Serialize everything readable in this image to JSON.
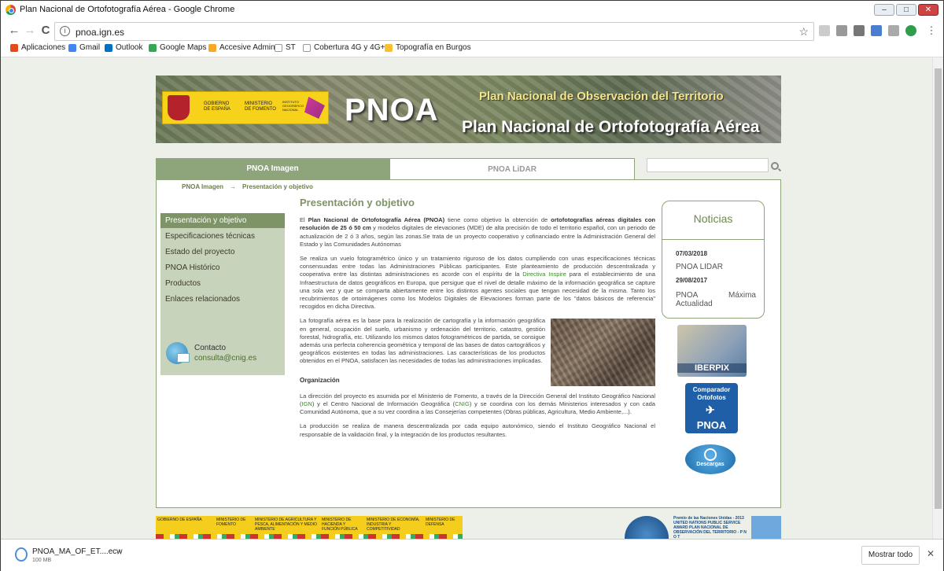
{
  "window": {
    "title": "Plan Nacional de Ortofotografía Aérea - Google Chrome",
    "min": "–",
    "max": "□",
    "close": "✕"
  },
  "toolbar": {
    "back": "←",
    "forward": "→",
    "reload": "C",
    "url": "pnoa.ign.es",
    "star": "☆"
  },
  "bookmarks": [
    {
      "label": "Aplicaciones",
      "color": "#e64a19"
    },
    {
      "label": "Gmail",
      "color": "#4285f4"
    },
    {
      "label": "Outlook",
      "color": "#0072c6"
    },
    {
      "label": "Google Maps",
      "color": "#34a853"
    },
    {
      "label": "Accesive Admin",
      "color": "#f9a825"
    },
    {
      "label": "ST",
      "color": "#bbbbbb"
    },
    {
      "label": "Cobertura 4G y 4G+...",
      "color": "#bbbbbb"
    },
    {
      "label": "Topografía en Burgos",
      "color": "#fbc02d"
    }
  ],
  "banner": {
    "gov1": "GOBIERNO DE ESPAÑA",
    "gov2": "MINISTERIO DE FOMENTO",
    "gov3": "INSTITUTO GEOGRÁFICO NACIONAL",
    "logo": "PNOA",
    "subtitle": "Plan Nacional de Observación del Territorio",
    "title": "Plan Nacional de Ortofotografía Aérea"
  },
  "tabs": {
    "imagen": "PNOA Imagen",
    "lidar": "PNOA LiDAR"
  },
  "breadcrumb": {
    "home": "PNOA Imagen",
    "sep": "→",
    "current": "Presentación y objetivo"
  },
  "sidebar": {
    "items": [
      "Presentación y objetivo",
      "Especificaciones técnicas",
      "Estado del proyecto",
      "PNOA Histórico",
      "Productos",
      "Enlaces relacionados"
    ],
    "contact_label": "Contacto",
    "contact_mail": "consulta@cnig.es"
  },
  "content": {
    "title": "Presentación y objetivo",
    "p1_a": "El ",
    "p1_b": "Plan Nacional de Ortofotografía Aérea (PNOA)",
    "p1_c": " tiene como objetivo la obtención de ",
    "p1_d": "ortofotografías aéreas digitales con resolución de 25 ó 50 cm",
    "p1_e": " y modelos digitales de elevaciones (MDE) de alta precisión de todo el territorio español, con un periodo de actualización de 2 ó 3 años, según las zonas.Se trata de un proyecto cooperativo y cofinanciado entre la Administración General del Estado y las Comunidades Autónomas",
    "p2_a": "Se realiza un vuelo fotogramétrico único y un tratamiento riguroso de los datos cumpliendo con unas especificaciones técnicas consensuadas entre todas las Administraciones Públicas participantes. Este planteamiento de producción descentralizada y cooperativa entre las distintas administraciones es acorde con el espíritu de la ",
    "p2_link": "Directiva Inspire",
    "p2_b": " para el establecimiento de una Infraestructura de datos geográficos en Europa, que persigue que el nivel de detalle máximo de la información geográfica se capture una sola vez y que se comparta abiertamente entre los distintos agentes sociales que tengan necesidad de la misma. Tanto los recubrimientos de ortoimágenes como los Modelos Digitales de Elevaciones forman parte de los \"datos básicos de referencia\" recogidos en dicha Directiva.",
    "p3": "La fotografía aérea es la base para la realización de cartografía y la información geográfica en general, ocupación del suelo, urbanismo y ordenación del territorio, catastro, gestión forestal, hidrografía, etc. Utilizando los mismos datos fotogramétricos de partida, se consigue además una perfecta coherencia geométrica y temporal de las bases de datos cartográficos y geográficos existentes en todas las administraciones. Las características de los productos obtenidos en el PNOA, satisfacen las necesidades de todas las administraciones implicadas.",
    "org_title": "Organización",
    "p4_a": "La dirección del proyecto es asumida por el Ministerio de Fomento, a través de la Dirección General del Instituto Geográfico Nacional (",
    "p4_ign": "IGN",
    "p4_b": ") y el Centro Nacional de Información Geográfica (",
    "p4_cnig": "CNIG",
    "p4_c": ") y se coordina con los demás Ministerios interesados y con cada Comunidad Autónoma, que a su vez coordina a las Consejerías competentes (Obras públicas, Agricultura, Medio Ambiente,...).",
    "p5": "La producción se realiza de manera descentralizada por cada equipo autonómico, siendo el Instituto Geográfico Nacional el responsable de la validación final, y la integración de los productos resultantes."
  },
  "news": {
    "title": "Noticias",
    "items": [
      {
        "date": "07/03/2018",
        "text": "PNOA LIDAR"
      },
      {
        "date": "29/08/2017",
        "text_a": "PNOA",
        "text_b": "Máxima",
        "text_c": "Actualidad"
      }
    ]
  },
  "promos": {
    "iberpix": "IBERPIX",
    "comparador_a": "Comparador",
    "comparador_b": "Ortofotos",
    "comparador_c": "PNOA",
    "descargas": "Descargas"
  },
  "footer": {
    "gov": "GOBIERNO DE ESPAÑA",
    "m1": "MINISTERIO DE FOMENTO",
    "m2": "MINISTERIO DE AGRICULTURA Y PESCA, ALIMENTACIÓN Y MEDIO AMBIENTE",
    "m3": "MINISTERIO DE HACIENDA Y FUNCIÓN PÚBLICA",
    "m4": "MINISTERIO DE ECONOMÍA, INDUSTRIA Y COMPETITIVIDAD",
    "m5": "MINISTERIO DE DEFENSA",
    "award": "Premio de las Naciones Unidas - 2013 UNITED NATIONS PUBLIC SERVICE AWARD PLAN NACIONAL DE OBSERVACIÓN DEL TERRITORIO - P N O T"
  },
  "download": {
    "name": "PNOA_MA_OF_ET....ecw",
    "size": "100 MB",
    "show_all": "Mostrar todo",
    "close": "✕"
  }
}
